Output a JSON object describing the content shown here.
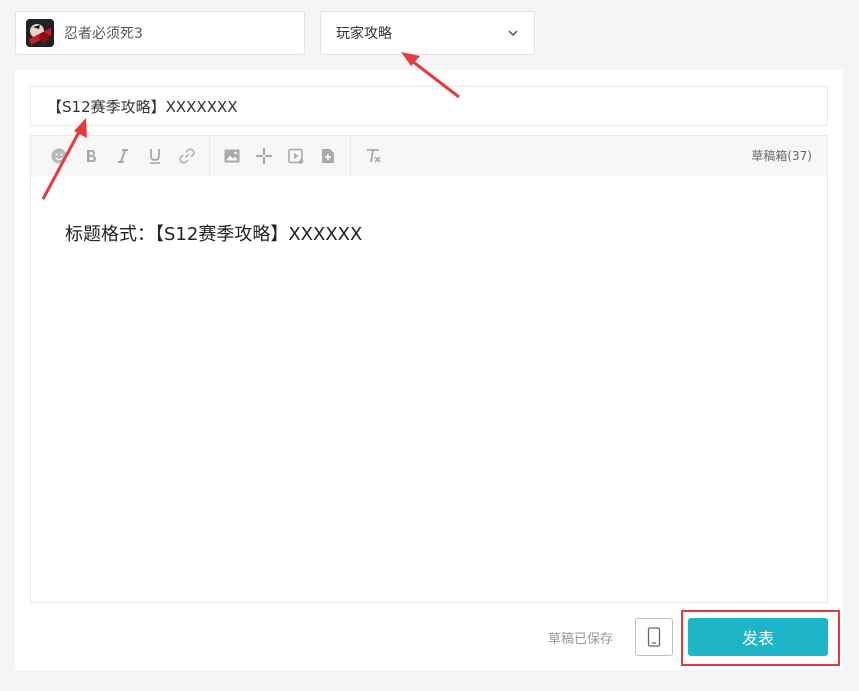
{
  "game": {
    "name": "忍者必须死3",
    "avatar_icon": "game-avatar-ninja"
  },
  "category": {
    "selected": "玩家攻略",
    "chevron_icon": "chevron-down-icon"
  },
  "title": {
    "value": "【S12赛季攻略】XXXXXXX"
  },
  "toolbar": {
    "icons": [
      "emoji-icon",
      "bold-icon",
      "italic-icon",
      "underline-icon",
      "link-icon",
      "image-icon",
      "sparkle-icon",
      "video-icon",
      "file-add-icon",
      "clear-format-icon"
    ],
    "drafts_label": "草稿箱(37)"
  },
  "editor": {
    "content": "标题格式：【S12赛季攻略】XXXXXX"
  },
  "footer": {
    "saved_status": "草稿已保存",
    "mobile_icon": "mobile-preview-icon",
    "publish_label": "发表"
  },
  "colors": {
    "publish": "#1db5c7",
    "highlight": "#e63b3b",
    "page_bg": "#f4f5f7"
  }
}
